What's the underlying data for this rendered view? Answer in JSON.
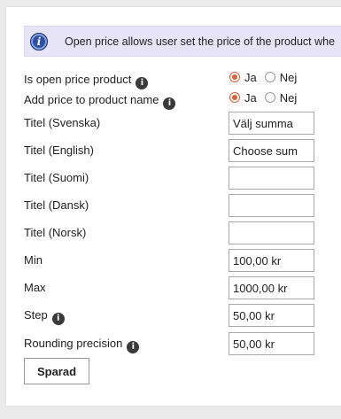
{
  "banner": {
    "icon": "info-icon",
    "text": "Open price allows user set the price of the product whe"
  },
  "rows": {
    "open_price": {
      "label": "Is open price product",
      "option_yes": "Ja",
      "option_no": "Nej",
      "selected": "Ja"
    },
    "add_price": {
      "label": "Add price to product name",
      "option_yes": "Ja",
      "option_no": "Nej",
      "selected": "Ja"
    },
    "title_sv": {
      "label": "Titel (Svenska)",
      "value": "Välj summa"
    },
    "title_en": {
      "label": "Titel (English)",
      "value": "Choose sum"
    },
    "title_fi": {
      "label": "Titel (Suomi)",
      "value": ""
    },
    "title_da": {
      "label": "Titel (Dansk)",
      "value": ""
    },
    "title_no": {
      "label": "Titel (Norsk)",
      "value": ""
    },
    "min": {
      "label": "Min",
      "value": "100,00 kr"
    },
    "max": {
      "label": "Max",
      "value": "1000,00 kr"
    },
    "step": {
      "label": "Step",
      "value": "50,00 kr"
    },
    "rounding": {
      "label": "Rounding precision",
      "value": "50,00 kr"
    }
  },
  "info_glyph": "i",
  "save_button": {
    "label": "Sparad"
  },
  "colors": {
    "banner_bg": "#e7e4f7",
    "radio_accent": "#d9623d",
    "page_bg": "#ebebeb"
  }
}
